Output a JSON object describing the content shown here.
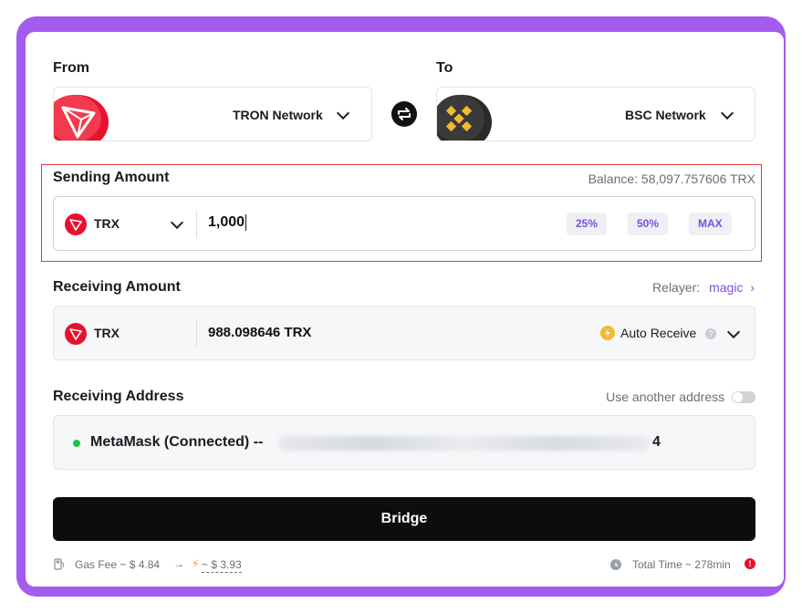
{
  "from": {
    "label": "From",
    "network": "TRON Network",
    "icon": "tron-logo-icon"
  },
  "to": {
    "label": "To",
    "network": "BSC Network",
    "icon": "bnb-logo-icon"
  },
  "swap_icon": "swap-arrows-icon",
  "sending": {
    "label": "Sending Amount",
    "balance": "Balance: 58,097.757606 TRX",
    "token": "TRX",
    "amount": "1,000",
    "buttons": [
      "25%",
      "50%",
      "MAX"
    ]
  },
  "receiving": {
    "label": "Receiving Amount",
    "relayer_label": "Relayer:",
    "relayer_value": "magic",
    "token": "TRX",
    "amount": "988.098646 TRX",
    "auto_receive": "Auto Receive",
    "help": "?"
  },
  "address": {
    "label": "Receiving Address",
    "toggle_label": "Use another address",
    "wallet": "MetaMask (Connected) --",
    "suffix": "4"
  },
  "bridge_label": "Bridge",
  "footer": {
    "gas_label": "Gas Fee ~ $ 4.84",
    "arrow": "→",
    "gas_new": "~ $ 3.93",
    "total_time": "Total Time ~ 278min",
    "warn": "!"
  },
  "colors": {
    "accent": "#7b4fe0",
    "frame": "#a45bf0",
    "tron_red": "#e8112d",
    "bnb_yellow": "#f3ba2f",
    "highlight": "#e03a3a"
  }
}
